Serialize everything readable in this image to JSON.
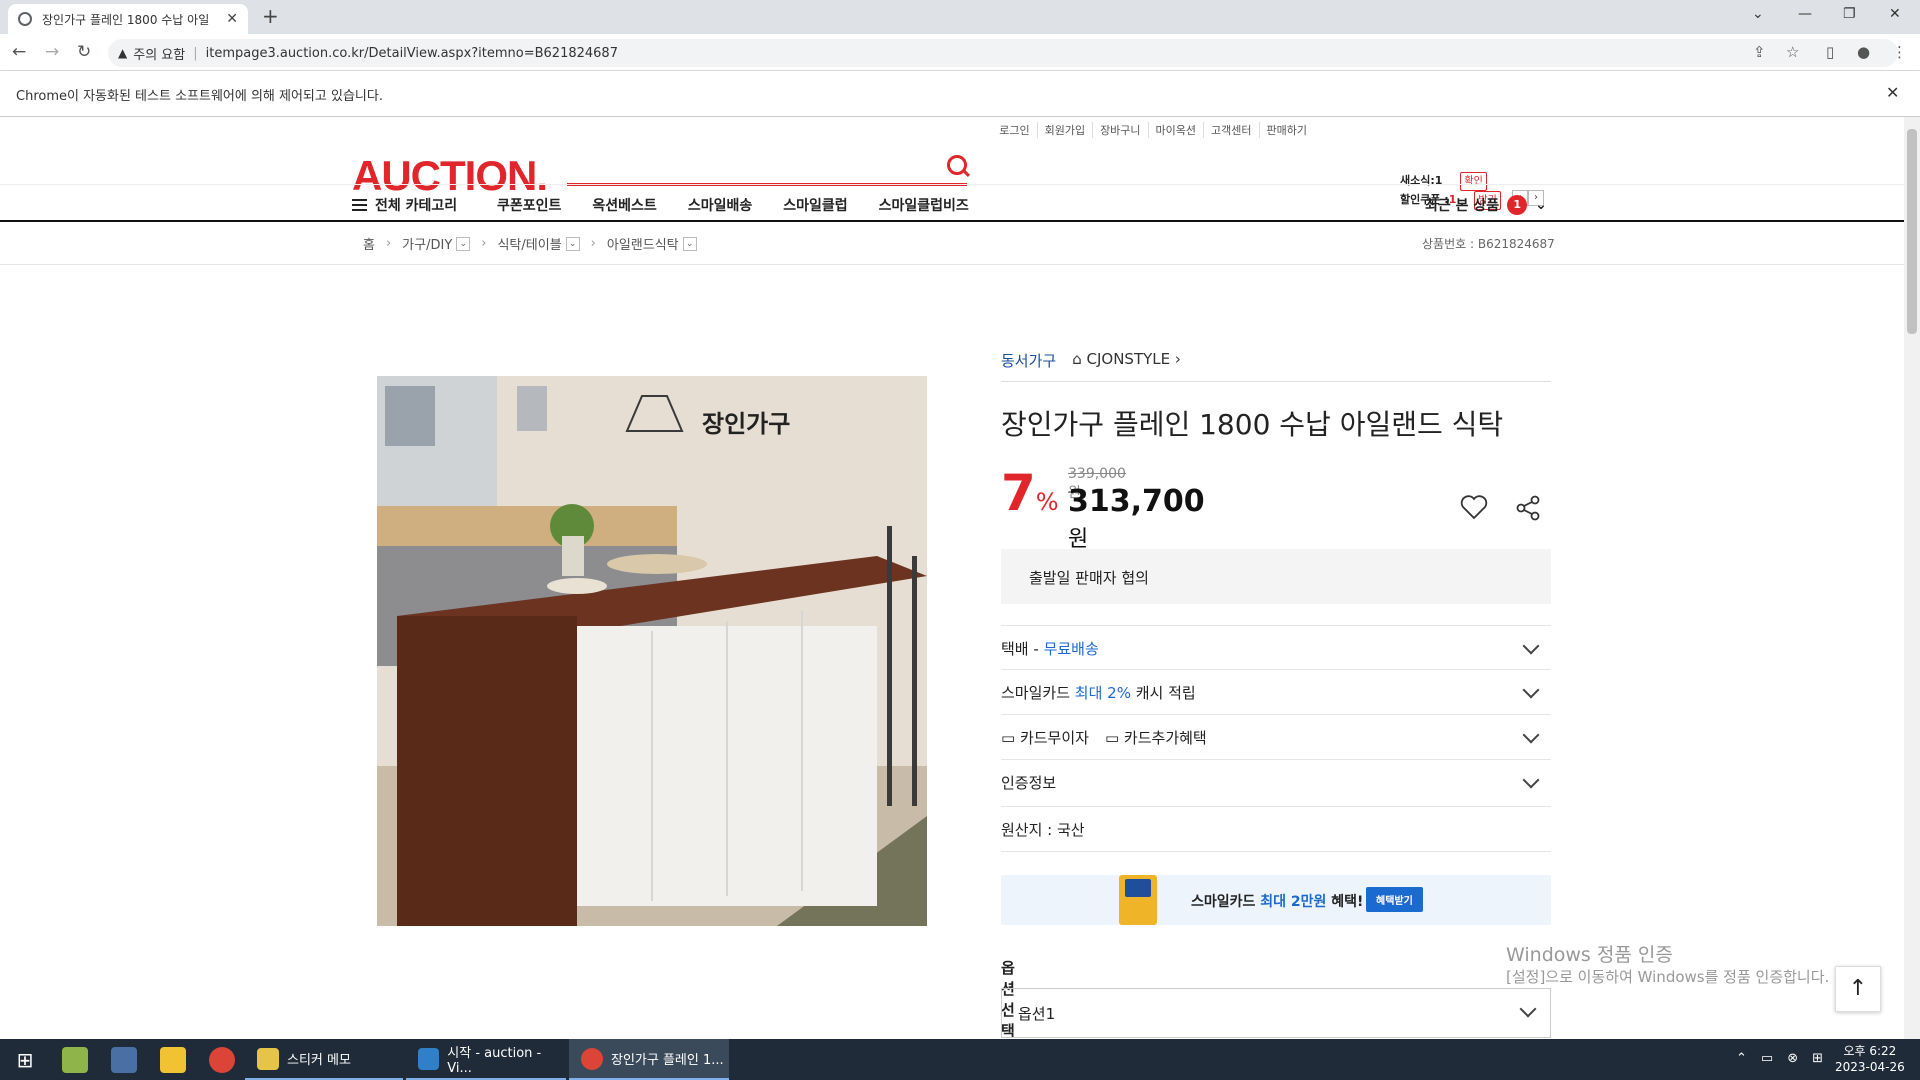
{
  "browser": {
    "tab_title": "장인가구 플레인 1800 수납 아일",
    "url_warning": "주의 요함",
    "url": "itempage3.auction.co.kr/DetailView.aspx?itemno=B621824687",
    "automation_notice": "Chrome이 자동화된 테스트 소프트웨어에 의해 제어되고 있습니다."
  },
  "header": {
    "util_links": [
      "로그인",
      "회원가입",
      "장바구니",
      "마이옥션",
      "고객센터",
      "판매하기"
    ],
    "logo": "AUCTION.",
    "new_coupon_label": "새소식:",
    "new_coupon_count": "1",
    "new_coupon_btn": "확인",
    "discount_coupon_label": "할인쿠폰 :",
    "discount_coupon_count": "1",
    "discount_coupon_btn": "받기"
  },
  "gnb": {
    "category": "전체 카테고리",
    "menu": [
      "쿠폰포인트",
      "옥션베스트",
      "스마일배송",
      "스마일클럽",
      "스마일클럽비즈"
    ],
    "recent_label": "최근 본 상품",
    "recent_count": "1"
  },
  "breadcrumb": {
    "home": "홈",
    "level1": "가구/DIY",
    "level2": "식탁/테이블",
    "level3": "아일랜드식탁",
    "product_no": "상품번호 : B621824687"
  },
  "product": {
    "seller_brand": "동서가구",
    "shop": "CJONSTYLE",
    "title": "장인가구 플레인 1800 수납 아일랜드 식탁",
    "discount_rate": "7",
    "discount_unit": "%",
    "original_price": "339,000원",
    "price": "313,700",
    "price_unit": "원",
    "image_brand_text": "장인가구",
    "shipping_note": "출발일 판매자 협의",
    "delivery_label": "택배 - ",
    "delivery_value": "무료배송",
    "smilecard_pre": "스마일카드 ",
    "smilecard_highlight": "최대 2%",
    "smilecard_post": " 캐시 적립",
    "card_interest": "카드무이자",
    "card_benefit": "카드추가혜택",
    "certification": "인증정보",
    "origin": "원산지 : 국산",
    "banner_pre": "스마일카드 ",
    "banner_highlight": "최대 2만원",
    "banner_post": " 혜택!",
    "banner_btn": "혜택받기",
    "option_label": "옵션선택",
    "option_value": "옵션1"
  },
  "watermark": {
    "line1": "Windows 정품 인증",
    "line2": "[설정]으로 이동하여 Windows를 정품 인증합니다."
  },
  "taskbar": {
    "apps": [
      "스티커 메모",
      "시작 - auction - Vi...",
      "장인가구 플레인 1..."
    ],
    "ampm": "오후 6:22",
    "date": "2023-04-26"
  }
}
